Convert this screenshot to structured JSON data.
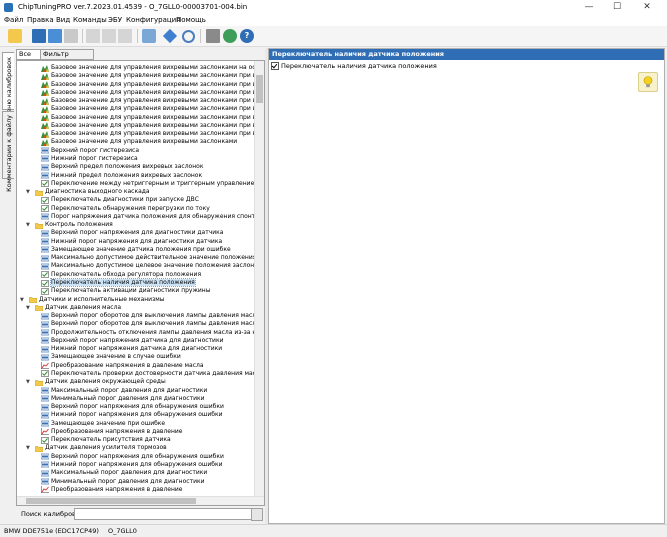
{
  "window": {
    "title": "ChipTuningPRO ver.7.2023.01.4539 - O_7GLL0-00003701-004.bin"
  },
  "menu": [
    "Файл",
    "Правка",
    "Вид",
    "Команды",
    "ЭБУ",
    "Конфигурация",
    "Помощь"
  ],
  "side_tabs": [
    "Меню калибровок",
    "Комментарии к файлу"
  ],
  "left_tabs": [
    "Все",
    "Фильтр"
  ],
  "tree": [
    {
      "depth": 3,
      "icon": "map-3d",
      "label": "Базовое значение для управления вихревыми заслонками на основе количе"
    },
    {
      "depth": 3,
      "icon": "map-3d",
      "label": "Базовое значение для управления вихревыми заслонками при высоком атмо"
    },
    {
      "depth": 3,
      "icon": "map-3d",
      "label": "Базовое значение для управления вихревыми заслонками при высоком атмо"
    },
    {
      "depth": 3,
      "icon": "map-3d",
      "label": "Базовое значение для управления вихревыми заслонками при высоком атмо"
    },
    {
      "depth": 3,
      "icon": "map-3d",
      "label": "Базовое значение для управления вихревыми заслонками при высоком атмо"
    },
    {
      "depth": 3,
      "icon": "map-3d",
      "label": "Базовое значение для управления вихревыми заслонками при высоком атмо"
    },
    {
      "depth": 3,
      "icon": "map-3d",
      "label": "Базовое значение для управления вихревыми заслонками при высоком атмо"
    },
    {
      "depth": 3,
      "icon": "map-3d",
      "label": "Базовое значение для управления вихревыми заслонками при высоком атмо"
    },
    {
      "depth": 3,
      "icon": "map-3d",
      "label": "Базовое значение для управления вихревыми заслонками при высоком атмо"
    },
    {
      "depth": 3,
      "icon": "map-3d",
      "label": "Базовое значение для управления вихревыми заслонками"
    },
    {
      "depth": 3,
      "icon": "value",
      "label": "Верхний порог гистерезиса"
    },
    {
      "depth": 3,
      "icon": "value",
      "label": "Нижний порог гистерезиса"
    },
    {
      "depth": 3,
      "icon": "value",
      "label": "Верхний предел положения вихревых заслонок"
    },
    {
      "depth": 3,
      "icon": "value",
      "label": "Нижний предел положения вихревых заслонок"
    },
    {
      "depth": 3,
      "icon": "check",
      "label": "Переключение между нетриггерным и триггерным управлением"
    },
    {
      "depth": 2,
      "icon": "folder",
      "label": "Диагностика выходного каскада",
      "expand": "v"
    },
    {
      "depth": 3,
      "icon": "check",
      "label": "Переключатель диагностики при запуске ДВС"
    },
    {
      "depth": 3,
      "icon": "check",
      "label": "Переключатель обнаружения перегрузки по току"
    },
    {
      "depth": 3,
      "icon": "value",
      "label": "Порог напряжения датчика положения для обнаружения спонтанного ры"
    },
    {
      "depth": 2,
      "icon": "folder",
      "label": "Контроль положения",
      "expand": "v"
    },
    {
      "depth": 3,
      "icon": "value",
      "label": "Верхний порог напряжения для диагностики датчика"
    },
    {
      "depth": 3,
      "icon": "value",
      "label": "Нижний порог напряжения для диагностики датчика"
    },
    {
      "depth": 3,
      "icon": "value",
      "label": "Замещающее значение датчика положения при ошибке"
    },
    {
      "depth": 3,
      "icon": "value",
      "label": "Максимально допустимое действительное значение положения заслонк"
    },
    {
      "depth": 3,
      "icon": "value",
      "label": "Максимально допустимое целевое значение положения заслонки"
    },
    {
      "depth": 3,
      "icon": "check",
      "label": "Переключатель обхода регулятора положения"
    },
    {
      "depth": 3,
      "icon": "check",
      "label": "Переключатель наличия датчика положения",
      "selected": true
    },
    {
      "depth": 3,
      "icon": "check",
      "label": "Переключатель активации диагностики пружины"
    },
    {
      "depth": 1,
      "icon": "folder",
      "label": "Датчики и исполнительные механизмы",
      "expand": "v"
    },
    {
      "depth": 2,
      "icon": "folder",
      "label": "Датчик давления масла",
      "expand": "v"
    },
    {
      "depth": 3,
      "icon": "value",
      "label": "Верхний порог оборотов для выключения лампы давления масла при пу"
    },
    {
      "depth": 3,
      "icon": "value",
      "label": "Верхний порог оборотов для выключения лампы давления масла"
    },
    {
      "depth": 3,
      "icon": "value",
      "label": "Продолжительность отключения лампы давления масла из-за низких об"
    },
    {
      "depth": 3,
      "icon": "value",
      "label": "Верхний порог напряжения датчика для диагностики"
    },
    {
      "depth": 3,
      "icon": "value",
      "label": "Нижний порог напряжения датчика для диагностики"
    },
    {
      "depth": 3,
      "icon": "value",
      "label": "Замещающее значение в случае ошибки"
    },
    {
      "depth": 3,
      "icon": "curve",
      "label": "Преобразование напряжения в давление масла"
    },
    {
      "depth": 3,
      "icon": "check",
      "label": "Переключатель проверки достоверности датчика давления масла"
    },
    {
      "depth": 2,
      "icon": "folder",
      "label": "Датчик давления окружающей среды",
      "expand": "v"
    },
    {
      "depth": 3,
      "icon": "value",
      "label": "Максимальный порог давления для диагностики"
    },
    {
      "depth": 3,
      "icon": "value",
      "label": "Минимальный порог давления для диагностики"
    },
    {
      "depth": 3,
      "icon": "value",
      "label": "Верхний порог напряжения для обнаружения ошибки"
    },
    {
      "depth": 3,
      "icon": "value",
      "label": "Нижний порог напряжения для обнаружения ошибки"
    },
    {
      "depth": 3,
      "icon": "value",
      "label": "Замещающее значение при ошибке"
    },
    {
      "depth": 3,
      "icon": "curve",
      "label": "Преобразования напряжения в давление"
    },
    {
      "depth": 3,
      "icon": "check",
      "label": "Переключатель присутствия датчика"
    },
    {
      "depth": 2,
      "icon": "folder",
      "label": "Датчик давления усилителя тормозов",
      "expand": "v"
    },
    {
      "depth": 3,
      "icon": "value",
      "label": "Верхний порог напряжения для обнаружения ошибки"
    },
    {
      "depth": 3,
      "icon": "value",
      "label": "Нижний порог напряжения для обнаружения ошибки"
    },
    {
      "depth": 3,
      "icon": "value",
      "label": "Максимальный порог давления для диагностики"
    },
    {
      "depth": 3,
      "icon": "value",
      "label": "Минимальный порог давления для диагностики"
    },
    {
      "depth": 3,
      "icon": "curve",
      "label": "Преобразования напряжения в давление"
    }
  ],
  "search": {
    "label": "Поиск калибровки",
    "value": ""
  },
  "detail": {
    "header": "Переключатель наличия датчика положения",
    "checkbox_label": "Переключатель наличия датчика положения",
    "checked": true
  },
  "status": {
    "ecu": "BMW DDE751e (EDC17CP49)",
    "file": "O_7GLL0"
  },
  "colors": {
    "header_blue": "#2f6db5",
    "selection": "#cce4f7"
  }
}
